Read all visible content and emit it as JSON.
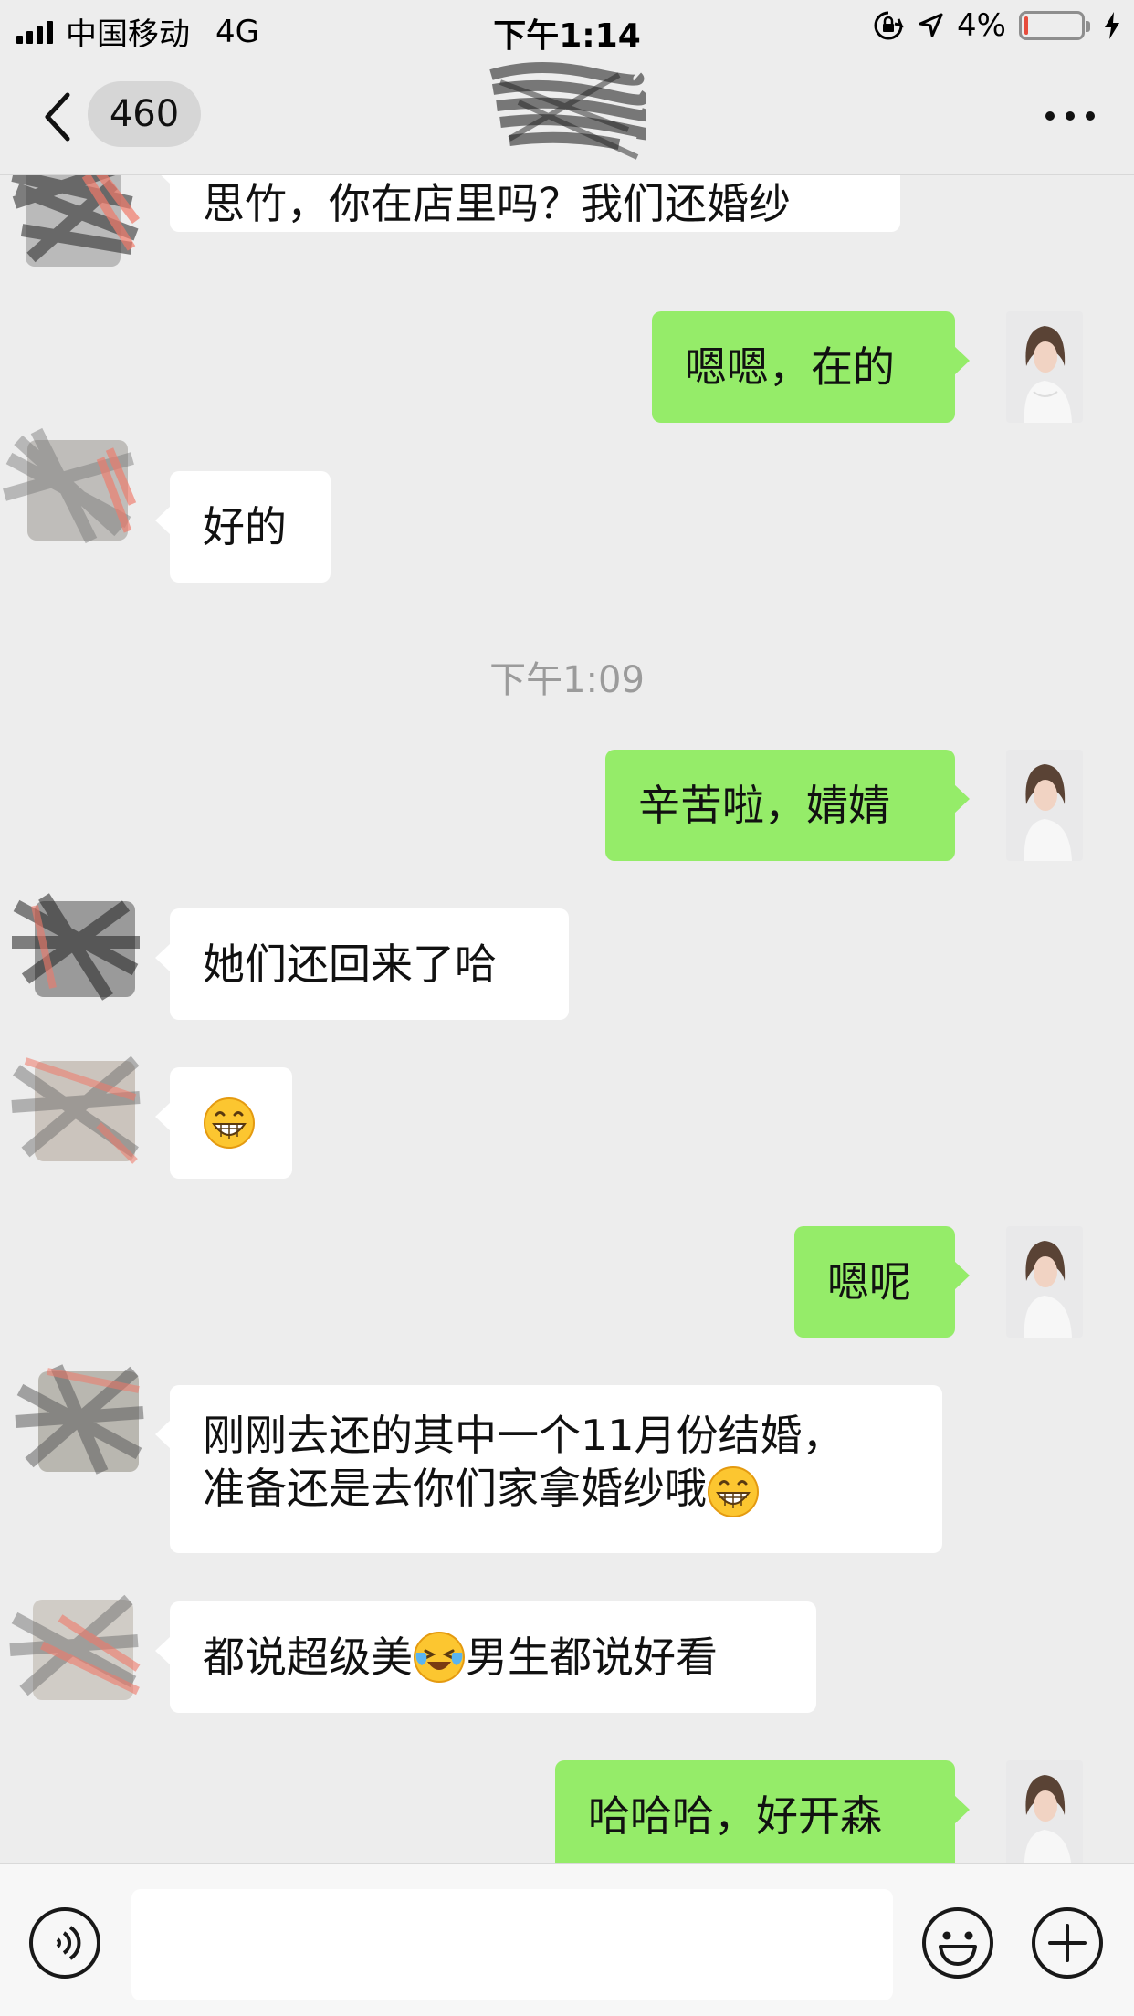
{
  "status_bar": {
    "carrier": "中国移动",
    "network": "4G",
    "time": "下午1:14",
    "battery_percent": "4%",
    "battery_level": 0.04,
    "battery_color": "#e74c3c"
  },
  "nav": {
    "back_badge": "460",
    "title": "",
    "more_icon": "more-icon"
  },
  "messages": [
    {
      "side": "in",
      "text": "思竹，你在店里吗？我们还婚纱"
    },
    {
      "side": "out",
      "text": "嗯嗯，在的"
    },
    {
      "side": "in",
      "text": "好的"
    },
    {
      "type": "time",
      "text": "下午1:09"
    },
    {
      "side": "out",
      "text": "辛苦啦，婧婧"
    },
    {
      "side": "in",
      "text": "她们还回来了哈"
    },
    {
      "side": "in",
      "emoji": "grin-emoji"
    },
    {
      "side": "out",
      "text": "嗯呢"
    },
    {
      "side": "in",
      "line1": "刚刚去还的其中一个11月份结婚，",
      "line2": "准备还是去你们家拿婚纱哦",
      "emoji": "grin-emoji"
    },
    {
      "side": "in",
      "part1": "都说超级美",
      "emoji": "laugh-cry-emoji",
      "part2": "男生都说好看"
    },
    {
      "side": "out",
      "text": "哈哈哈，好开森"
    }
  ],
  "input_bar": {
    "placeholder": "",
    "voice_icon": "voice-icon",
    "emoji_icon": "emoji-icon",
    "plus_icon": "plus-icon"
  },
  "colors": {
    "background": "#ededed",
    "outgoing_bubble": "#95ec69",
    "incoming_bubble": "#ffffff"
  }
}
